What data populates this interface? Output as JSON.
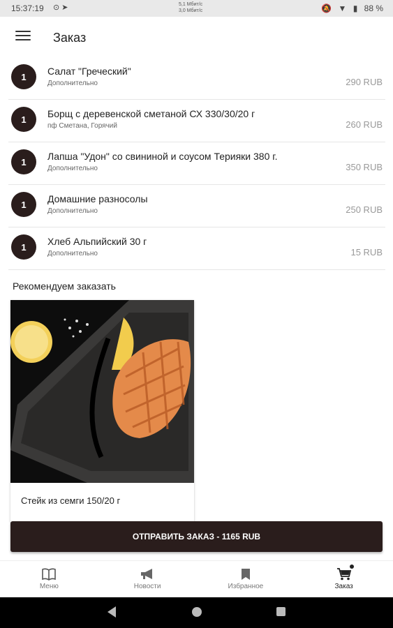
{
  "status_bar": {
    "time": "15:37:19",
    "left_icons": "⊙ ➤",
    "net_up": "5,1 Мбит/с",
    "net_down": "3,0 Мбит/с",
    "battery": "88 %"
  },
  "header": {
    "title": "Заказ"
  },
  "order": {
    "items": [
      {
        "qty": "1",
        "name": "Салат \"Греческий\"",
        "sub": "Дополнительно",
        "price": "290 RUB"
      },
      {
        "qty": "1",
        "name": "Борщ с деревенской сметаной СХ  330/30/20 г",
        "sub": "пф Сметана, Горячий",
        "price": "260 RUB"
      },
      {
        "qty": "1",
        "name": "Лапша \"Удон\" со свининой и соусом Терияки 380 г.",
        "sub": "Дополнительно",
        "price": "350 RUB"
      },
      {
        "qty": "1",
        "name": "Домашние разносолы",
        "sub": "Дополнительно",
        "price": "250 RUB"
      },
      {
        "qty": "1",
        "name": "Хлеб Альпийский 30 г",
        "sub": "Дополнительно",
        "price": "15 RUB"
      }
    ]
  },
  "recommended": {
    "title": "Рекомендуем заказать",
    "card": {
      "name": "Стейк из семги 150/20 г"
    }
  },
  "submit": {
    "label": "ОТПРАВИТЬ ЗАКАЗ - 1165 RUB"
  },
  "nav": {
    "items": [
      {
        "label": "Меню",
        "icon": "book-icon"
      },
      {
        "label": "Новости",
        "icon": "megaphone-icon"
      },
      {
        "label": "Избранное",
        "icon": "bookmark-icon"
      },
      {
        "label": "Заказ",
        "icon": "cart-icon"
      }
    ],
    "active": "Заказ"
  },
  "colors": {
    "accent": "#2a1d1c",
    "price": "#999999"
  }
}
